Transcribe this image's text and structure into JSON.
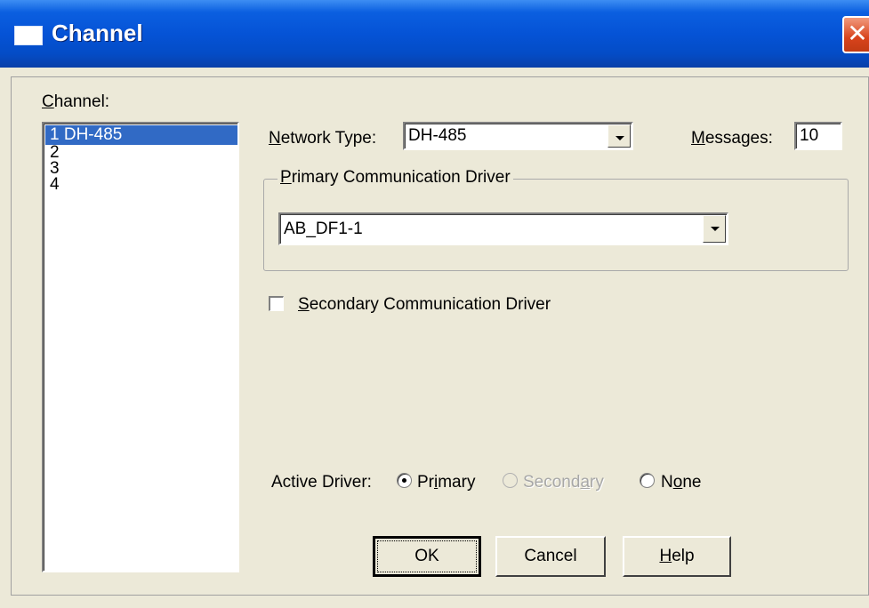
{
  "window": {
    "title": "Channel",
    "close_glyph": "✕"
  },
  "channel": {
    "label_underlined": "C",
    "label_rest": "hannel:",
    "items": [
      {
        "number": "1",
        "name": "DH-485",
        "selected": true
      },
      {
        "number": "2",
        "name": ""
      },
      {
        "number": "3",
        "name": ""
      },
      {
        "number": "4",
        "name": ""
      }
    ]
  },
  "network_type": {
    "label_underlined": "N",
    "label_rest": "etwork Type:",
    "value": "DH-485"
  },
  "messages": {
    "label_underlined": "M",
    "label_rest": "essages:",
    "value": "10"
  },
  "primary_driver": {
    "group_underlined": "P",
    "group_rest": "rimary Communication Driver",
    "value": "AB_DF1-1"
  },
  "secondary_driver": {
    "checkbox_underlined": "S",
    "checkbox_rest": "econdary Communication Driver",
    "checked": false
  },
  "active_driver": {
    "label": "Active Driver:",
    "options": [
      {
        "pre": "Pr",
        "underlined": "i",
        "post": "mary",
        "checked": true,
        "enabled": true
      },
      {
        "pre": "Second",
        "underlined": "a",
        "post": "ry",
        "checked": false,
        "enabled": false
      },
      {
        "pre": "N",
        "underlined": "o",
        "post": "ne",
        "checked": false,
        "enabled": true
      }
    ]
  },
  "buttons": {
    "ok": "OK",
    "cancel": "Cancel",
    "help_underlined": "H",
    "help_rest": "elp"
  },
  "colors": {
    "titlebar": "#0553d6",
    "selection": "#316ac5",
    "dialog_face": "#ece9d8",
    "close_button": "#d8431c"
  }
}
